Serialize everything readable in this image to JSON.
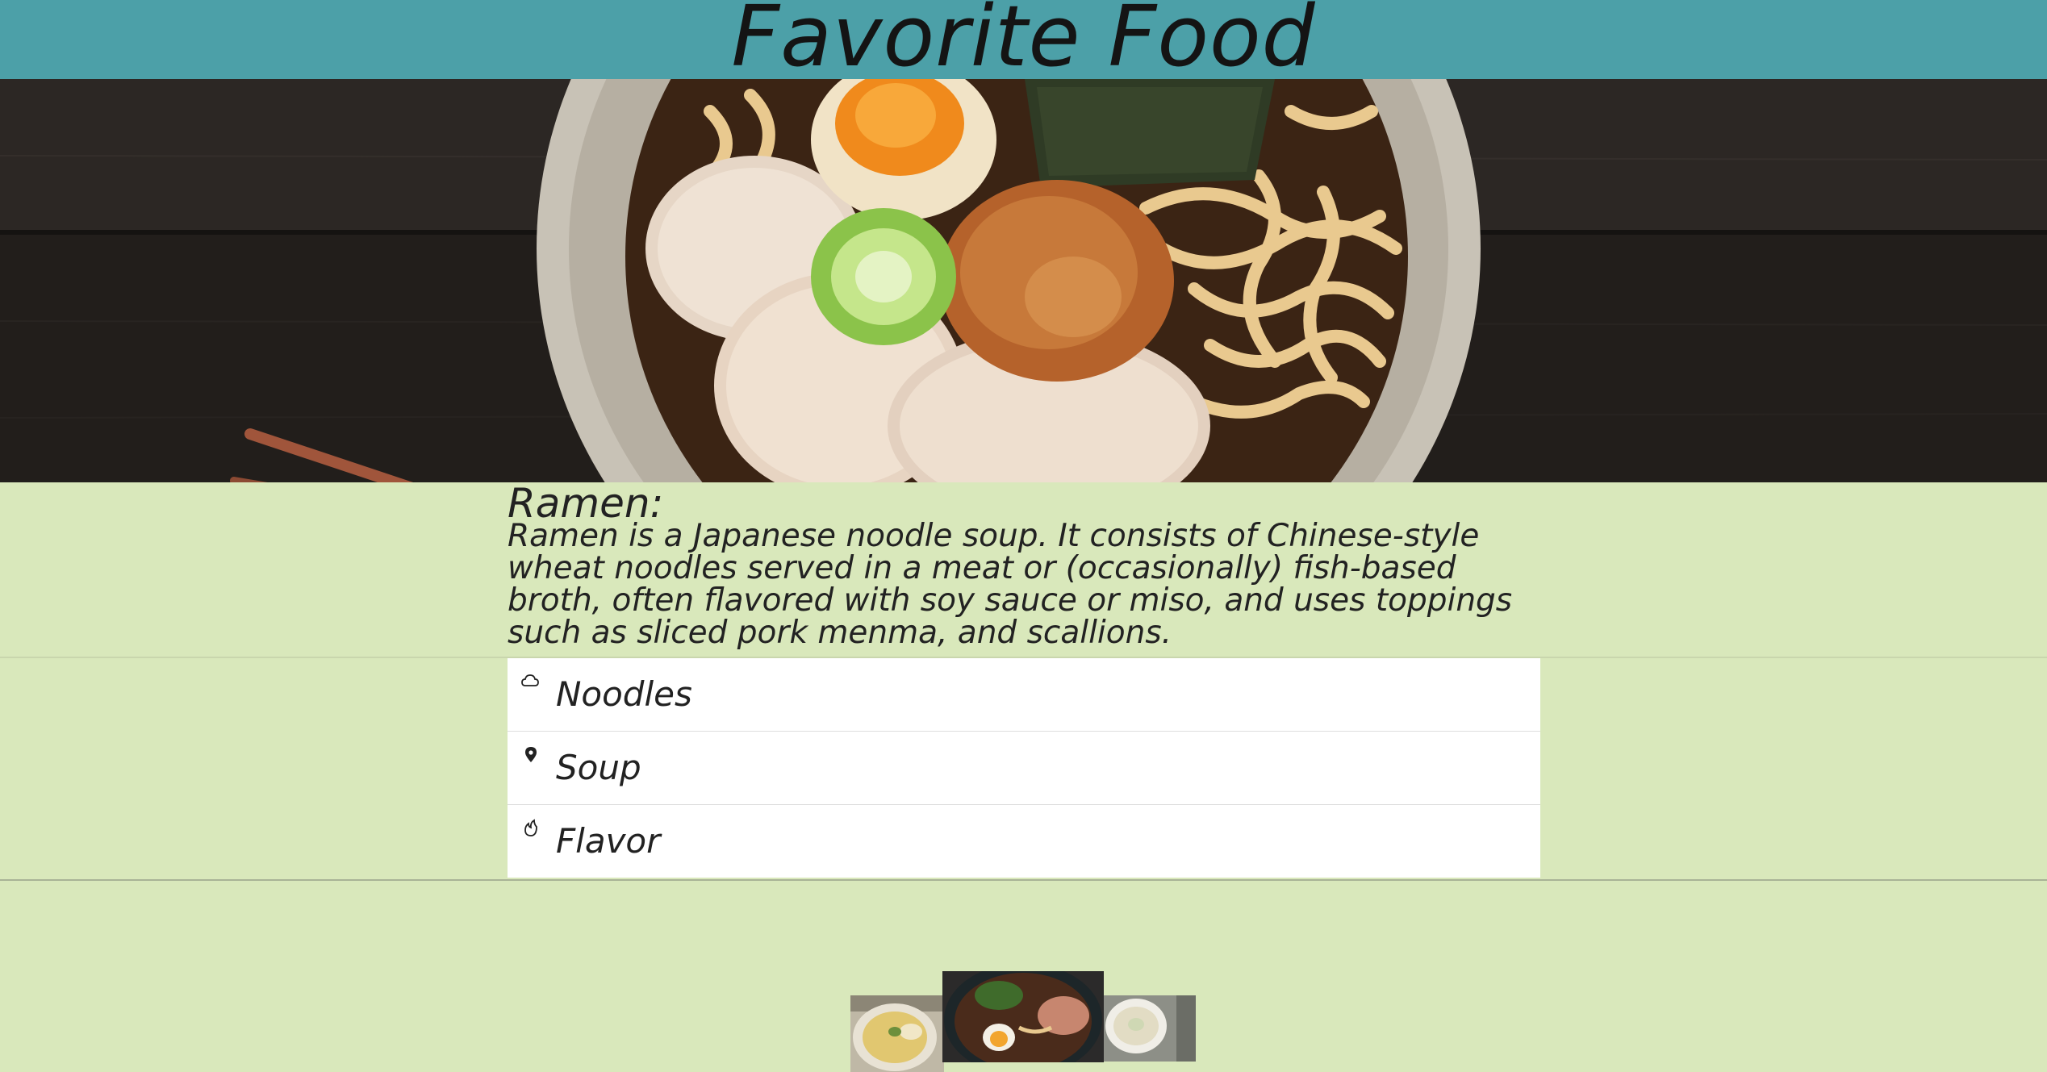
{
  "header": {
    "title": "Favorite Food"
  },
  "hero": {
    "image_name": "ramen-bowl-photo"
  },
  "info": {
    "title": "Ramen:",
    "description": "Ramen is a Japanese noodle soup. It consists of Chinese-style wheat noodles served in a meat or (occasionally) fish-based broth, often flavored with soy sauce or miso, and uses toppings such as sliced pork menma, and scallions."
  },
  "list": {
    "items": [
      {
        "label": "Noodles",
        "icon": "cloud-icon"
      },
      {
        "label": "Soup",
        "icon": "map-pin-icon"
      },
      {
        "label": "Flavor",
        "icon": "flame-icon"
      }
    ]
  },
  "gallery": {
    "thumbnails": [
      {
        "name": "noodle-bowl-thumbnail"
      },
      {
        "name": "ramen-thumbnail"
      },
      {
        "name": "soup-bowl-thumbnail"
      }
    ]
  },
  "colors": {
    "header_bg": "#4ca0a8",
    "page_bg": "#d9e8bb",
    "list_bg": "#ffffff",
    "text": "#222222"
  }
}
